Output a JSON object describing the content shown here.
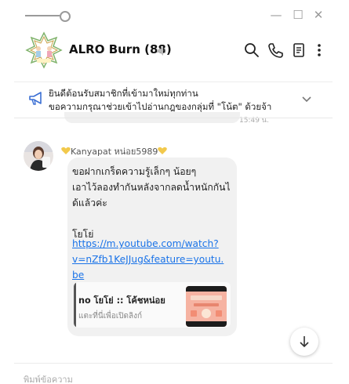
{
  "window": {
    "pin_icon": "pin-window-icon",
    "controls": {
      "minimize": "—",
      "maximize": "☐",
      "close": "✕"
    }
  },
  "header": {
    "group_name": "ALRO Burn (88)",
    "group_avatar_text": "Alro Burn",
    "actions": [
      "search-icon",
      "call-icon",
      "notes-icon",
      "more-icon"
    ]
  },
  "announcement": {
    "line1": "ยินดีต้อนรับสมาชิกที่เข้ามาใหม่ทุกท่าน",
    "line2": "ขอความกรุณาช่วยเข้าไปอ่านกฎของกลุ่มที่ \"โน้ต\" ด้วยจ้า",
    "previous_time": "15:49 น."
  },
  "message": {
    "sender": "Kanyapat หน่อย5989",
    "text_lines": [
      "ขอฝากเกร็ดความรู้เล็กๆ น้อยๆ",
      "เอาไว้ลองทำกันหลังจากลดน้ำหนักกันไ",
      "ด้แล้วค่ะ",
      "",
      "โยโย่"
    ],
    "link_lines": [
      "https://m.youtube.com/watch?",
      "v=nZfb1KeJJug&feature=youtu.",
      "be"
    ],
    "preview": {
      "title": "no โยโย่ :: โค้ชหน่อย",
      "subtitle": "แตะที่นี่เพื่อเปิดลิงก์"
    }
  },
  "input": {
    "placeholder": "พิมพ์ข้อความ"
  },
  "colors": {
    "link": "#1a73e8",
    "heart": "#f2c94c",
    "bubble": "#f1f1f1"
  }
}
